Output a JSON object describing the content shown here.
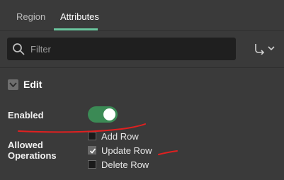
{
  "tabs": [
    {
      "label": "Region",
      "active": false
    },
    {
      "label": "Attributes",
      "active": true
    }
  ],
  "filter": {
    "placeholder": "Filter",
    "value": ""
  },
  "section": {
    "title": "Edit",
    "expanded": true
  },
  "fields": {
    "enabled": {
      "label": "Enabled",
      "value": true
    },
    "allowed_operations": {
      "label_line1": "Allowed",
      "label_line2": "Operations",
      "options": [
        {
          "label": "Add Row",
          "checked": false
        },
        {
          "label": "Update Row",
          "checked": true
        },
        {
          "label": "Delete Row",
          "checked": false
        }
      ]
    }
  },
  "colors": {
    "accent": "#6cc79f",
    "toggle_on": "#3b8a55",
    "annotation": "#e02020",
    "background": "#3a3a3a"
  }
}
